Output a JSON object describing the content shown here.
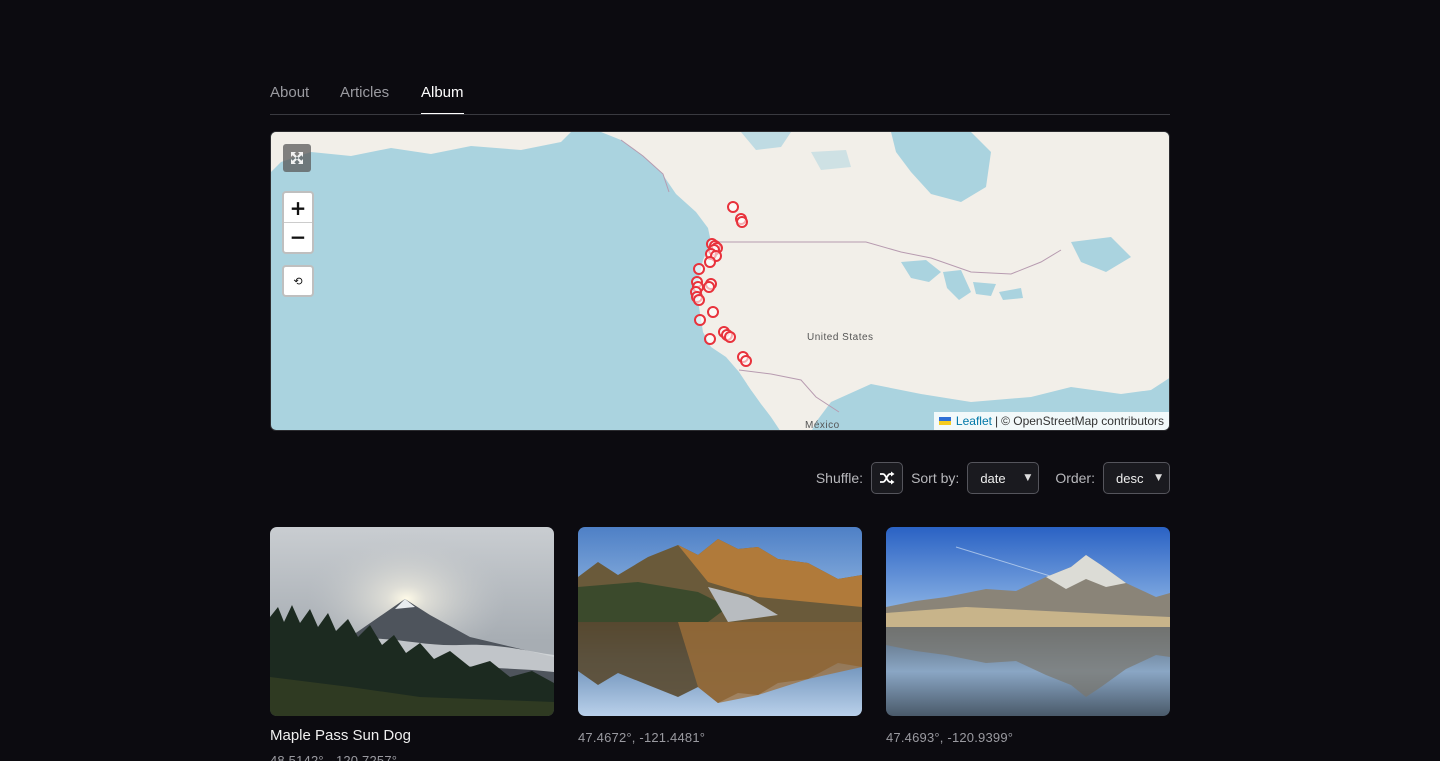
{
  "nav": {
    "tabs": [
      {
        "label": "About"
      },
      {
        "label": "Articles"
      },
      {
        "label": "Album"
      }
    ],
    "active_tab": "Album"
  },
  "map": {
    "labels": {
      "country": "United States",
      "mexico": "México"
    },
    "zoom_in": "+",
    "zoom_out": "−",
    "reset_glyph": "⟲",
    "attribution": {
      "link": "Leaflet",
      "separator": "|",
      "text": "© OpenStreetMap contributors"
    },
    "marker_color": "#e8323c",
    "water_color": "#aad3df",
    "land_color": "#f2efe9"
  },
  "controls": {
    "shuffle_label": "Shuffle:",
    "sort_label": "Sort by:",
    "sort_value": "date",
    "order_label": "Order:",
    "order_value": "desc"
  },
  "photos": [
    {
      "title": "Maple Pass Sun Dog",
      "coords": "48.5142°, -120.7257°",
      "icon": "mountain-photo"
    },
    {
      "title": "",
      "coords": "47.4672°, -121.4481°",
      "icon": "lake-reflection-photo"
    },
    {
      "title": "",
      "coords": "47.4693°, -120.9399°",
      "icon": "alpine-lake-photo"
    }
  ]
}
